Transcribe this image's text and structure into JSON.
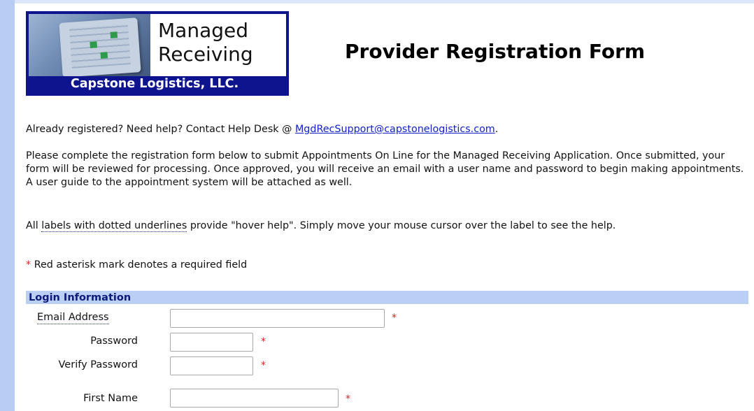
{
  "logo": {
    "line1": "Managed",
    "line2": "Receiving",
    "company": "Capstone Logistics, LLC."
  },
  "page_title": "Provider Registration Form",
  "help_line": {
    "prefix": "Already registered? Need help? Contact Help Desk @ ",
    "email": "MgdRecSupport@capstonelogistics.com",
    "suffix": "."
  },
  "instructions": "Please complete the registration form below to submit Appointments On Line for the Managed Receiving Application. Once submitted, your form will be reviewed for processing. Once approved, you will receive an email with a user name and password to begin making appointments. A user guide to the appointment system will be attached as well.",
  "hover_help": {
    "prefix": "All ",
    "link_text": "labels with dotted underlines",
    "suffix": " provide \"hover help\". Simply move your mouse cursor over the label to see the help."
  },
  "required_note": {
    "asterisk": "*",
    "text": " Red asterisk mark denotes a required field"
  },
  "section": {
    "title": "Login Information",
    "fields": [
      {
        "label": "Email Address",
        "value": "",
        "required": true
      },
      {
        "label": "Password",
        "value": "",
        "required": true
      },
      {
        "label": "Verify Password",
        "value": "",
        "required": true
      },
      {
        "label": "First Name",
        "value": "",
        "required": true
      }
    ]
  },
  "colors": {
    "side_bar": "#b7cdf3",
    "section_bar": "#b9cff3",
    "logo_blue": "#0d148e",
    "required_red": "#e0202a",
    "link_blue": "#1122cc"
  }
}
